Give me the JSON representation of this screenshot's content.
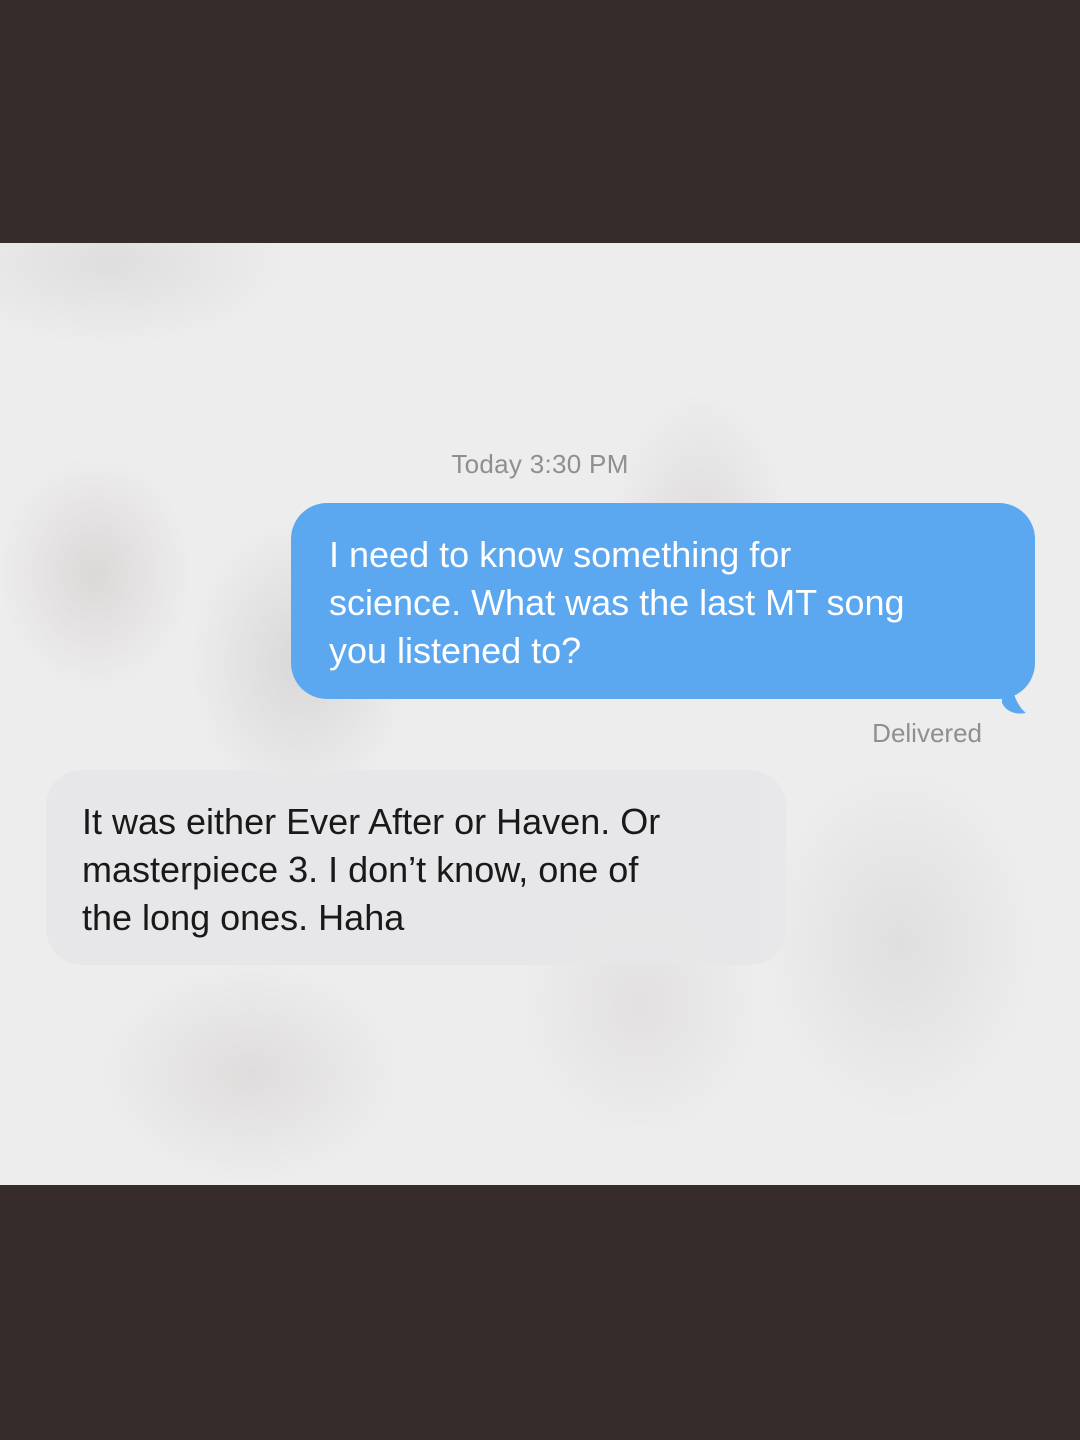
{
  "conversation": {
    "timestamp": "Today 3:30 PM",
    "messages": [
      {
        "direction": "outgoing",
        "lines": [
          "I need to know something for",
          "science. What was the last MT song",
          "you listened to?"
        ],
        "status": "Delivered"
      },
      {
        "direction": "incoming",
        "lines": [
          "It was either Ever After or Haven. Or",
          "masterpiece 3.  I don’t know, one of",
          "the long ones. Haha"
        ]
      }
    ]
  },
  "colors": {
    "outgoing_bubble": "#5ca8f0",
    "incoming_bubble": "#e7e7e9",
    "letterbox": "#362d2b",
    "meta_text": "#8e8e93"
  }
}
